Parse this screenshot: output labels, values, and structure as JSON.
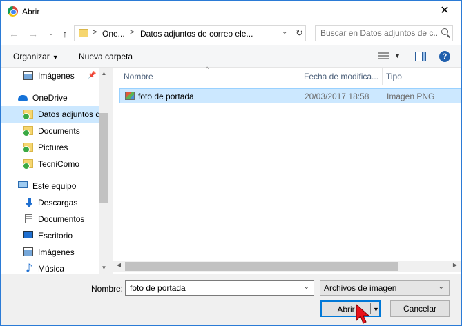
{
  "window": {
    "title": "Abrir"
  },
  "nav": {
    "back": "←",
    "forward": "→",
    "recent": "⌄",
    "up": "↑"
  },
  "address": {
    "crumbs": [
      "One...",
      "Datos adjuntos de correo ele..."
    ],
    "refresh": "↻"
  },
  "search": {
    "placeholder": "Buscar en Datos adjuntos de c..."
  },
  "toolbar": {
    "organize_label": "Organizar",
    "new_folder_label": "Nueva carpeta",
    "help": "?"
  },
  "sidebar": {
    "items": [
      {
        "label": "Imágenes",
        "icon": "images-icon"
      },
      {
        "label": "OneDrive",
        "icon": "onedrive-icon"
      },
      {
        "label": "Datos adjuntos de correo electrónico",
        "icon": "folder-icon"
      },
      {
        "label": "Documents",
        "icon": "folder-icon"
      },
      {
        "label": "Pictures",
        "icon": "folder-icon"
      },
      {
        "label": "TecniComo",
        "icon": "folder-icon"
      },
      {
        "label": "Este equipo",
        "icon": "computer-icon"
      },
      {
        "label": "Descargas",
        "icon": "download-icon"
      },
      {
        "label": "Documentos",
        "icon": "documents-icon"
      },
      {
        "label": "Escritorio",
        "icon": "desktop-icon"
      },
      {
        "label": "Imágenes",
        "icon": "images-icon"
      },
      {
        "label": "Música",
        "icon": "music-icon"
      }
    ],
    "selected_index": 2
  },
  "files": {
    "columns": [
      "Nombre",
      "Fecha de modifica...",
      "Tipo"
    ],
    "rows": [
      {
        "name": "foto de portada",
        "date": "20/03/2017 18:58",
        "type": "Imagen PNG"
      }
    ]
  },
  "footer": {
    "name_label": "Nombre:",
    "name_value": "foto de portada",
    "filter_value": "Archivos de imagen",
    "open_label": "Abrir",
    "cancel_label": "Cancelar"
  },
  "colors": {
    "selection": "#cce8ff",
    "accent": "#0078d7"
  }
}
